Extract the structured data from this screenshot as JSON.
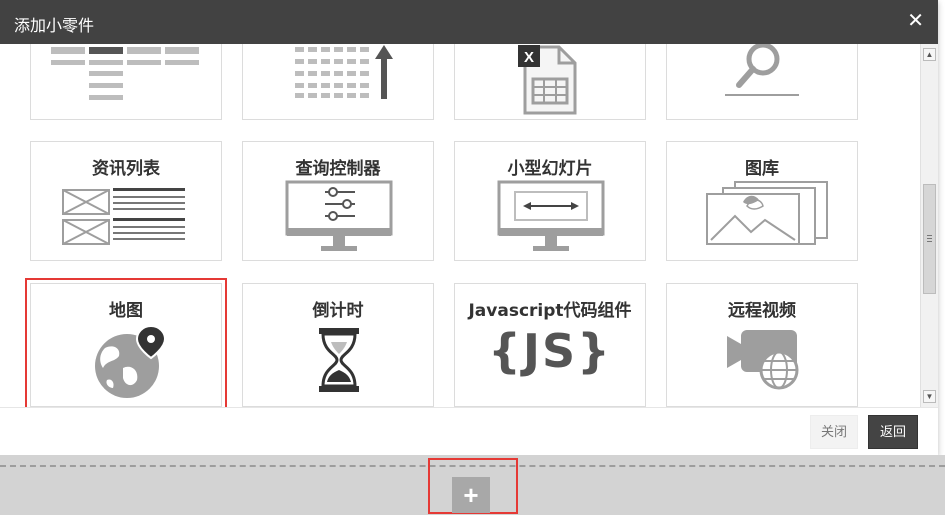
{
  "dialog": {
    "title": "添加小零件",
    "close_glyph": "✕"
  },
  "widgets": {
    "row1": [
      {
        "icon": "table-icon"
      },
      {
        "icon": "sort-ascending-icon"
      },
      {
        "icon": "excel-file-icon",
        "badge": "X"
      },
      {
        "icon": "search-icon"
      }
    ],
    "row2": [
      {
        "label": "资讯列表",
        "icon": "news-list-icon"
      },
      {
        "label": "查询控制器",
        "icon": "query-controller-icon"
      },
      {
        "label": "小型幻灯片",
        "icon": "mini-slideshow-icon"
      },
      {
        "label": "图库",
        "icon": "gallery-icon"
      }
    ],
    "row3": [
      {
        "label": "地图",
        "icon": "globe-map-icon",
        "selected": true
      },
      {
        "label": "倒计时",
        "icon": "hourglass-icon"
      },
      {
        "label": "Javascript代码组件",
        "icon": "js-icon",
        "icon_text": "{JS}"
      },
      {
        "label": "远程视频",
        "icon": "remote-video-icon"
      }
    ]
  },
  "footer": {
    "close_label": "关闭",
    "back_label": "返回"
  },
  "page": {
    "add_glyph": "+"
  },
  "colors": {
    "titlebar": "#424242",
    "highlight": "#e53935",
    "icon_gray": "#8a8a8a"
  }
}
